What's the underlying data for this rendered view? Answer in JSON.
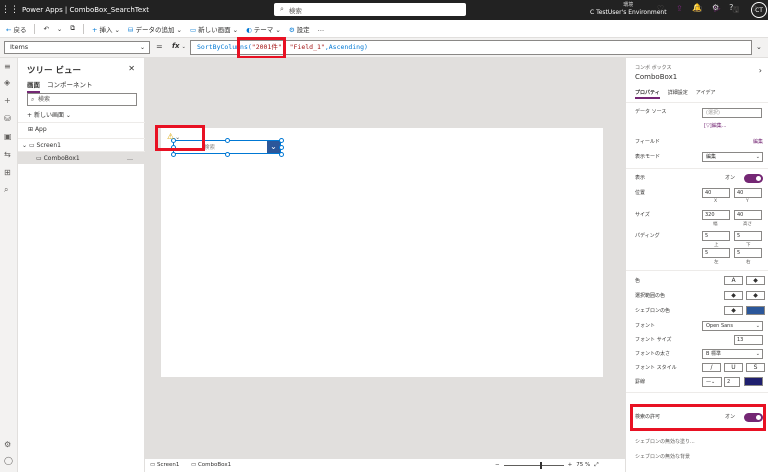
{
  "topbar": {
    "app_title": "Power Apps | ComboBox_SearchText",
    "search_placeholder": "検索",
    "env_label": "環境",
    "env_name": "C TestUser's Environment",
    "avatar": "CT"
  },
  "cmdbar": {
    "back": "戻る",
    "insert": "挿入",
    "add_data": "データの追加",
    "new_screen": "新しい画面",
    "theme": "テーマ",
    "settings": "設定",
    "more": "…"
  },
  "formula": {
    "property": "Items",
    "eq": "=",
    "fx": "fx",
    "code_prefix": "SortByColumns(",
    "code_string": "\"2001件\"",
    "code_sep": ", ",
    "code_field": "\"Field_1\"",
    "code_suffix": ",Ascending)"
  },
  "tree": {
    "title": "ツリー ビュー",
    "tab_screens": "画面",
    "tab_components": "コンポーネント",
    "search_placeholder": "検索",
    "new_screen": "新しい画面",
    "items": [
      "App",
      "Screen1",
      "ComboBox1"
    ],
    "more": "…"
  },
  "canvas": {
    "combo_placeholder": "検索"
  },
  "status": {
    "screen": "Screen1",
    "control": "ComboBox1",
    "zoom": "75 %",
    "zoom_level": 0.6
  },
  "props": {
    "category": "コンボ ボックス",
    "name": "ComboBox1",
    "tab_properties": "プロパティ",
    "tab_advanced": "詳細設定",
    "tab_ideas": "アイデア",
    "data_source_label": "データ ソース",
    "data_source_value": "(選択)",
    "edit_link": "[▽]編集...",
    "fields_label": "フィールド",
    "fields_link": "編集",
    "display_mode_label": "表示モード",
    "display_mode_value": "編集",
    "visible_label": "表示",
    "visible_value": "オン",
    "position_label": "位置",
    "pos_x": "40",
    "pos_y": "40",
    "x_label": "X",
    "y_label": "Y",
    "size_label": "サイズ",
    "width": "320",
    "height": "40",
    "w_label": "幅",
    "h_label": "高さ",
    "padding_label": "パディング",
    "pad_top": "5",
    "pad_bottom": "5",
    "pad_left": "5",
    "pad_right": "5",
    "pad_top_label": "上",
    "pad_bottom_label": "下",
    "pad_left_label": "左",
    "pad_right_label": "右",
    "color_label": "色",
    "select_color_label": "選択範囲の色",
    "chevron_color_label": "シェブロンの色",
    "font_label": "フォント",
    "font_value": "Open Sans",
    "font_size_label": "フォント サイズ",
    "font_size_value": "13",
    "font_weight_label": "フォントの太さ",
    "font_weight_value": "B 標準",
    "font_style_label": "フォント スタイル",
    "border_label": "罫線",
    "border_value": "2",
    "search_allowed_label": "検索の許可",
    "search_allowed_value": "オン",
    "chevron_disabled_label": "シェブロンの無効な塗り...",
    "chevron_disabled2_label": "シェブロンの無効な背景"
  }
}
